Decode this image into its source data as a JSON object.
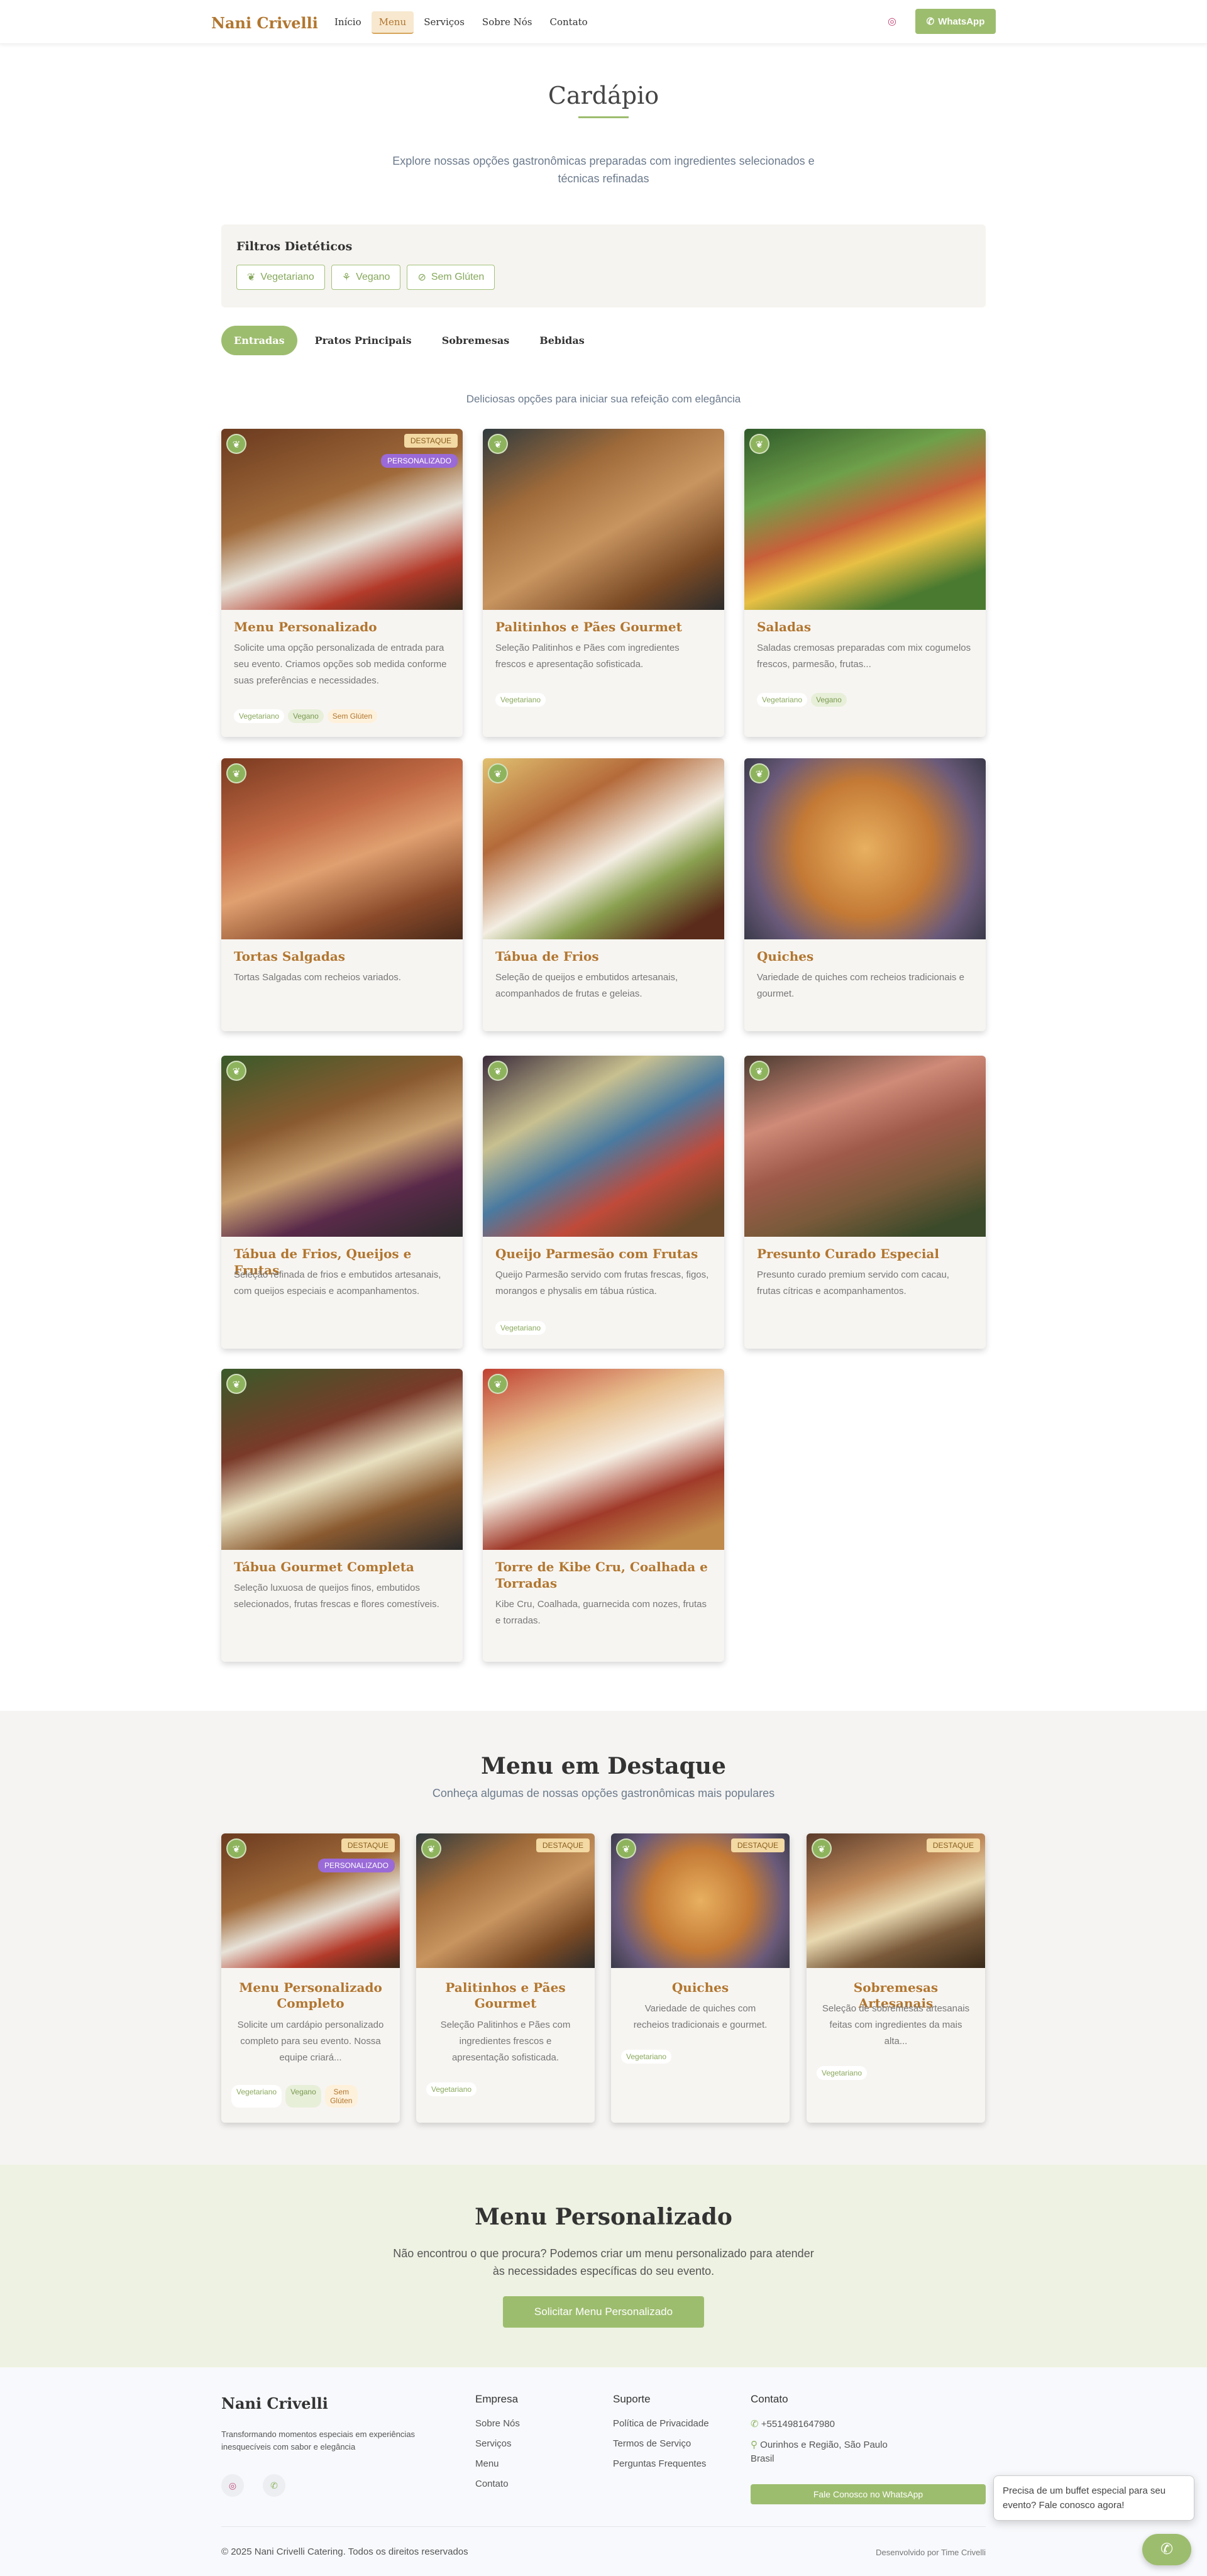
{
  "nav": {
    "brand": "Nani Crivelli",
    "links": [
      "Início",
      "Menu",
      "Serviços",
      "Sobre Nós",
      "Contato"
    ],
    "whatsapp": "WhatsApp"
  },
  "hero": {
    "title": "Cardápio",
    "subtitle": "Explore nossas opções gastronômicas preparadas com ingredientes selecionados e técnicas refinadas"
  },
  "filters": {
    "title": "Filtros Dietéticos",
    "options": [
      "Vegetariano",
      "Vegano",
      "Sem Glúten"
    ]
  },
  "tabs": [
    "Entradas",
    "Pratos Principais",
    "Sobremesas",
    "Bebidas"
  ],
  "tab_description": "Deliciosas opções para iniciar sua refeição com elegância",
  "badges": {
    "featured": "DESTAQUE",
    "custom": "PERSONALIZADO"
  },
  "tag_labels": {
    "veg": "Vegetariano",
    "vgn": "Vegano",
    "gf": "Sem Glúten"
  },
  "menu_items": [
    {
      "title": "Menu Personalizado",
      "desc": "Solicite uma opção personalizada de entrada para seu evento. Criamos opções sob medida conforme suas preferências e necessidades."
    },
    {
      "title": "Palitinhos e Pães Gourmet",
      "desc": "Seleção Palitinhos e Pães com ingredientes frescos e apresentação sofisticada."
    },
    {
      "title": "Saladas",
      "desc": "Saladas cremosas preparadas com mix cogumelos frescos, parmesão, frutas..."
    },
    {
      "title": "Tortas Salgadas",
      "desc": "Tortas Salgadas com recheios variados."
    },
    {
      "title": "Tábua de Frios",
      "desc": "Seleção de queijos e embutidos artesanais, acompanhados de frutas e geleias."
    },
    {
      "title": "Quiches",
      "desc": "Variedade de quiches com recheios tradicionais e gourmet."
    },
    {
      "title": "Tábua de Frios, Queijos e Frutas",
      "desc": "Seleção refinada de frios e embutidos artesanais, com queijos especiais e acompanhamentos."
    },
    {
      "title": "Queijo Parmesão com Frutas",
      "desc": "Queijo Parmesão servido com frutas frescas, figos, morangos e physalis em tábua rústica."
    },
    {
      "title": "Presunto Curado Especial",
      "desc": "Presunto curado premium servido com cacau, frutas cítricas e acompanhamentos."
    },
    {
      "title": "Tábua Gourmet Completa",
      "desc": "Seleção luxuosa de queijos finos, embutidos selecionados, frutas frescas e flores comestíveis."
    },
    {
      "title": "Torre de Kibe Cru, Coalhada e Torradas",
      "desc": "Kibe Cru, Coalhada, guarnecida com nozes, frutas e torradas."
    }
  ],
  "featured": {
    "title": "Menu em Destaque",
    "subtitle": "Conheça algumas de nossas opções gastronômicas mais populares",
    "items": [
      {
        "title": "Menu Personalizado Completo",
        "desc": "Solicite um cardápio personalizado completo para seu evento. Nossa equipe criará..."
      },
      {
        "title": "Palitinhos e Pães Gourmet",
        "desc": "Seleção Palitinhos e Pães com ingredientes frescos e apresentação sofisticada."
      },
      {
        "title": "Quiches",
        "desc": "Variedade de quiches com recheios tradicionais e gourmet."
      },
      {
        "title": "Sobremesas Artesanais",
        "desc": "Seleção de sobremesas artesanais feitas com ingredientes da mais alta..."
      }
    ]
  },
  "custom": {
    "title": "Menu Personalizado",
    "subtitle": "Não encontrou o que procura? Podemos criar um menu personalizado para atender às necessidades específicas do seu evento.",
    "button": "Solicitar Menu Personalizado"
  },
  "footer": {
    "brand": "Nani Crivelli",
    "tagline": "Transformando momentos especiais em experiências inesquecíveis com sabor e elegância",
    "company_title": "Empresa",
    "company_links": [
      "Sobre Nós",
      "Serviços",
      "Menu",
      "Contato"
    ],
    "support_title": "Suporte",
    "support_links": [
      "Política de Privacidade",
      "Termos de Serviço",
      "Perguntas Frequentes"
    ],
    "contact_title": "Contato",
    "phone": "+5514981647980",
    "address": "Ourinhos e Região, São Paulo Brasil",
    "whatsapp_btn": "Fale Conosco no WhatsApp",
    "copyright": "© 2025 Nani Crivelli Catering. Todos os direitos reservados",
    "developer": "Desenvolvido por Time Crivelli"
  },
  "chat_popup": "Precisa de um buffet especial para seu evento? Fale conosco agora!",
  "colors": {
    "accent": "#9dbd6e",
    "brand": "#b2762f"
  }
}
